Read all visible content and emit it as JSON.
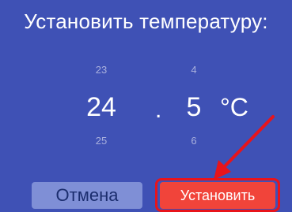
{
  "dialog": {
    "title": "Установить температуру:",
    "picker_integer": {
      "prev": "23",
      "current": "24",
      "next": "25"
    },
    "separator": ".",
    "picker_decimal": {
      "prev": "4",
      "current": "5",
      "next": "6"
    },
    "unit": "°C",
    "cancel_label": "Отмена",
    "set_label": "Установить"
  },
  "colors": {
    "background": "#3f51b5",
    "cancel_button": "#7f8fd6",
    "set_button": "#f1443a",
    "annotation": "#e8141b"
  },
  "icons": {
    "annotation_arrow": "red-arrow-icon"
  }
}
